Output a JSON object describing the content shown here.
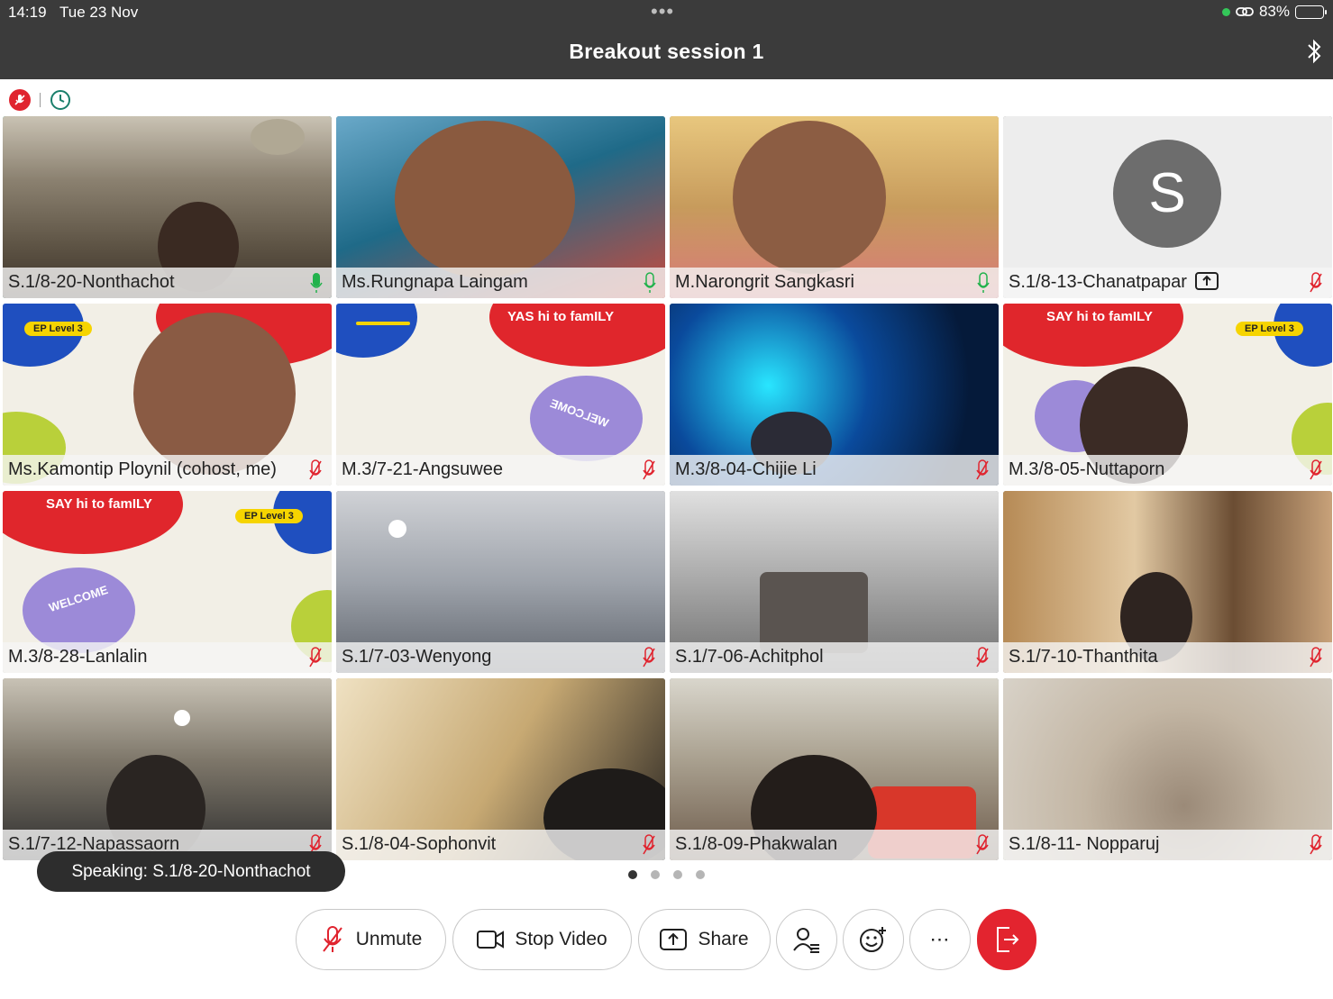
{
  "status_bar": {
    "time": "14:19",
    "date": "Tue 23 Nov",
    "battery": "83%",
    "battery_level": 0.83
  },
  "header": {
    "title": "Breakout session 1"
  },
  "participants": [
    {
      "name": "S.1/8-20-Nonthachot",
      "mic": "active",
      "active_speaker": true
    },
    {
      "name": "Ms.Rungnapa Laingam",
      "mic": "active"
    },
    {
      "name": "M.Narongrit Sangkasri",
      "mic": "active"
    },
    {
      "name": "S.1/8-13-Chanatpapar",
      "mic": "muted",
      "avatar_letter": "S",
      "sharing_icon": "share-upload-icon"
    },
    {
      "name": "Ms.Kamontip Ploynil (cohost, me)",
      "mic": "muted"
    },
    {
      "name": "M.3/7-21-Angsuwee",
      "mic": "muted"
    },
    {
      "name": "M.3/8-04-Chijie Li",
      "mic": "muted"
    },
    {
      "name": "M.3/8-05-Nuttaporn",
      "mic": "muted"
    },
    {
      "name": "M.3/8-28-Lanlalin",
      "mic": "muted"
    },
    {
      "name": "S.1/7-03-Wenyong",
      "mic": "muted"
    },
    {
      "name": "S.1/7-06-Achitphol",
      "mic": "muted"
    },
    {
      "name": "S.1/7-10-Thanthita",
      "mic": "muted"
    },
    {
      "name": "S.1/7-12-Napassaorn",
      "mic": "muted"
    },
    {
      "name": "S.1/8-04-Sophonvit",
      "mic": "muted"
    },
    {
      "name": "S.1/8-09-Phakwalan",
      "mic": "muted"
    },
    {
      "name": "S.1/8-11- Nopparuj",
      "mic": "muted"
    }
  ],
  "poster": {
    "headline": "SAY hi to famILY",
    "headline_mirrored": "YAS hi to famILY",
    "level": "EP Level 3",
    "level_mirrored": "EP Level 3",
    "welcome": "WELCOME"
  },
  "speaking": {
    "text": "Speaking: S.1/8-20-Nonthachot"
  },
  "pagination": {
    "pages": 4,
    "current": 1
  },
  "toolbar": {
    "unmute": "Unmute",
    "stop_video": "Stop Video",
    "share": "Share"
  },
  "colors": {
    "accent_active": "#2fbfae",
    "mic_active": "#22b24c",
    "mic_muted": "#e0242f",
    "leave": "#e3242f",
    "bar": "#3b3b3b"
  }
}
